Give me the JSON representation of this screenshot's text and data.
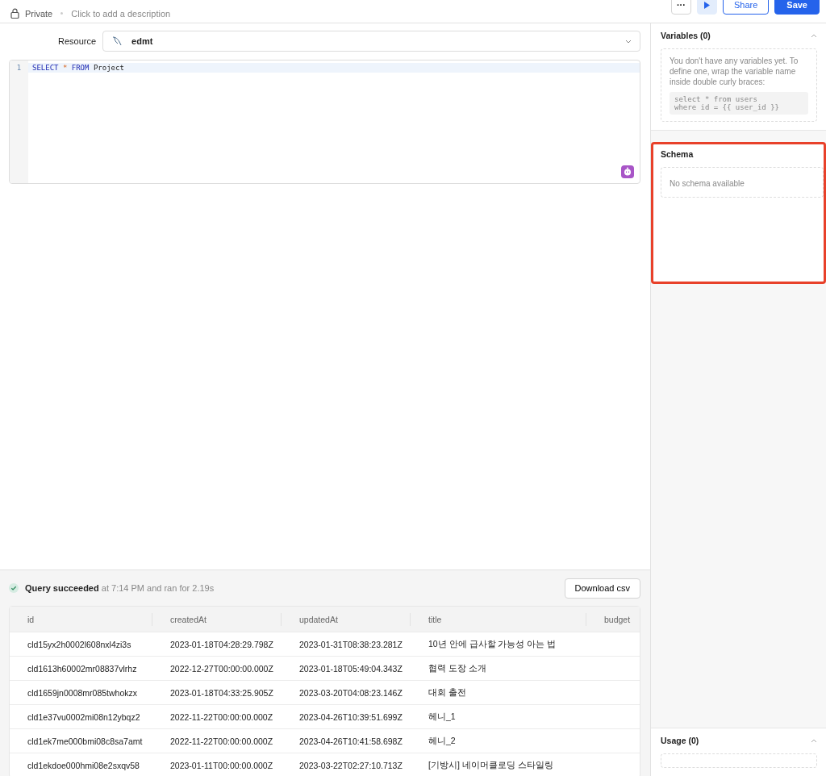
{
  "header": {
    "visibility": "Private",
    "description_placeholder": "Click to add a description",
    "more_button": "···",
    "share_button": "Share",
    "save_button": "Save"
  },
  "resource": {
    "label": "Resource",
    "value": "edmt"
  },
  "editor": {
    "lines": [
      {
        "number": "1",
        "tokens": [
          {
            "kind": "keyword",
            "text": "SELECT"
          },
          {
            "kind": "operator",
            "text": "*"
          },
          {
            "kind": "keyword",
            "text": "FROM"
          },
          {
            "kind": "plain",
            "text": "Project"
          }
        ]
      }
    ]
  },
  "variables": {
    "title": "Variables (0)",
    "expanded": true,
    "hint": "You don't have any variables yet. To define one, wrap the variable name inside double curly braces:",
    "example": [
      "select * from users",
      "where id = {{ user_id }}"
    ]
  },
  "schema": {
    "title": "Schema",
    "empty": "No schema available",
    "highlighted": true
  },
  "usage": {
    "title": "Usage (0)",
    "expanded": true
  },
  "result": {
    "status": "Query succeeded",
    "detail": "at 7:14 PM and ran for 2.19s",
    "download_button": "Download csv"
  },
  "table": {
    "columns": [
      "id",
      "createdAt",
      "updatedAt",
      "title",
      "budget"
    ],
    "rows": [
      [
        "cld15yx2h0002l608nxl4zi3s",
        "2023-01-18T04:28:29.798Z",
        "2023-01-31T08:38:23.281Z",
        "10년 안에 급사할 가능성 아는 법"
      ],
      [
        "cld1613h60002mr08837vlrhz",
        "2022-12-27T00:00:00.000Z",
        "2023-01-18T05:49:04.343Z",
        "협력 도장 소개"
      ],
      [
        "cld1659jn0008mr085twhokzx",
        "2023-01-18T04:33:25.905Z",
        "2023-03-20T04:08:23.146Z",
        "대회 출전"
      ],
      [
        "cld1e37vu0002mi08n12ybqz2",
        "2022-11-22T00:00:00.000Z",
        "2023-04-26T10:39:51.699Z",
        "헤니_1"
      ],
      [
        "cld1ek7me000bmi08c8sa7amt",
        "2022-11-22T00:00:00.000Z",
        "2023-04-26T10:41:58.698Z",
        "헤니_2"
      ],
      [
        "cld1ekdoe000hmi08e2sxqv58",
        "2023-01-11T00:00:00.000Z",
        "2023-03-22T02:27:10.713Z",
        "[기방시] 네이머클로딩 스타일링"
      ]
    ]
  }
}
